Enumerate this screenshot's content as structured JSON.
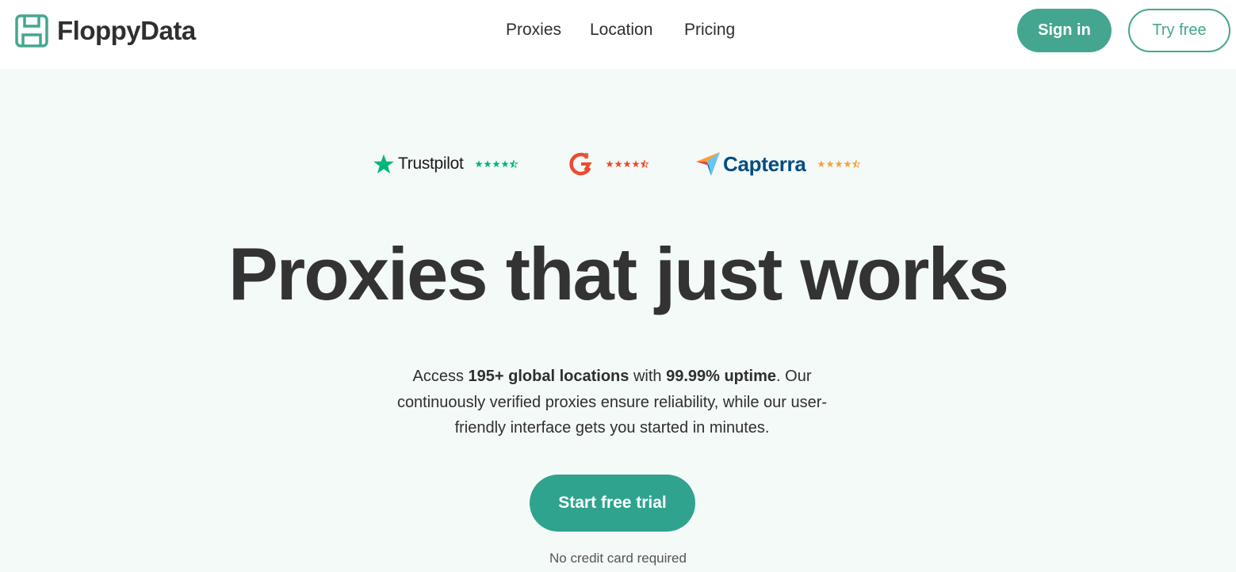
{
  "brand": {
    "name": "FloppyData",
    "accent_color": "#45a690",
    "cta_color": "#2fa38e",
    "hero_background": "#f4faf8"
  },
  "nav": {
    "items": [
      {
        "label": "Proxies"
      },
      {
        "label": "Location"
      },
      {
        "label": "Pricing"
      }
    ],
    "signin_label": "Sign in",
    "tryfree_label": "Try free"
  },
  "ratings": [
    {
      "name": "Trustpilot",
      "icon": "trustpilot-star-icon",
      "stars": 4.5,
      "star_color": "#00b67a"
    },
    {
      "name": "G2",
      "icon": "g2-logo-icon",
      "stars": 4.5,
      "star_color": "#ef4a2e"
    },
    {
      "name": "Capterra",
      "icon": "capterra-logo-icon",
      "stars": 4.5,
      "star_color": "#f7a23b"
    }
  ],
  "hero": {
    "headline": "Proxies that just works",
    "subtext": {
      "part1": "Access ",
      "bold1": "195+ global locations",
      "part2": " with ",
      "bold2": "99.99% uptime",
      "part3": ". Our continuously verified proxies ensure reliability, while our user-friendly interface gets you started in minutes."
    },
    "cta_label": "Start free trial",
    "note": "No credit card required"
  }
}
